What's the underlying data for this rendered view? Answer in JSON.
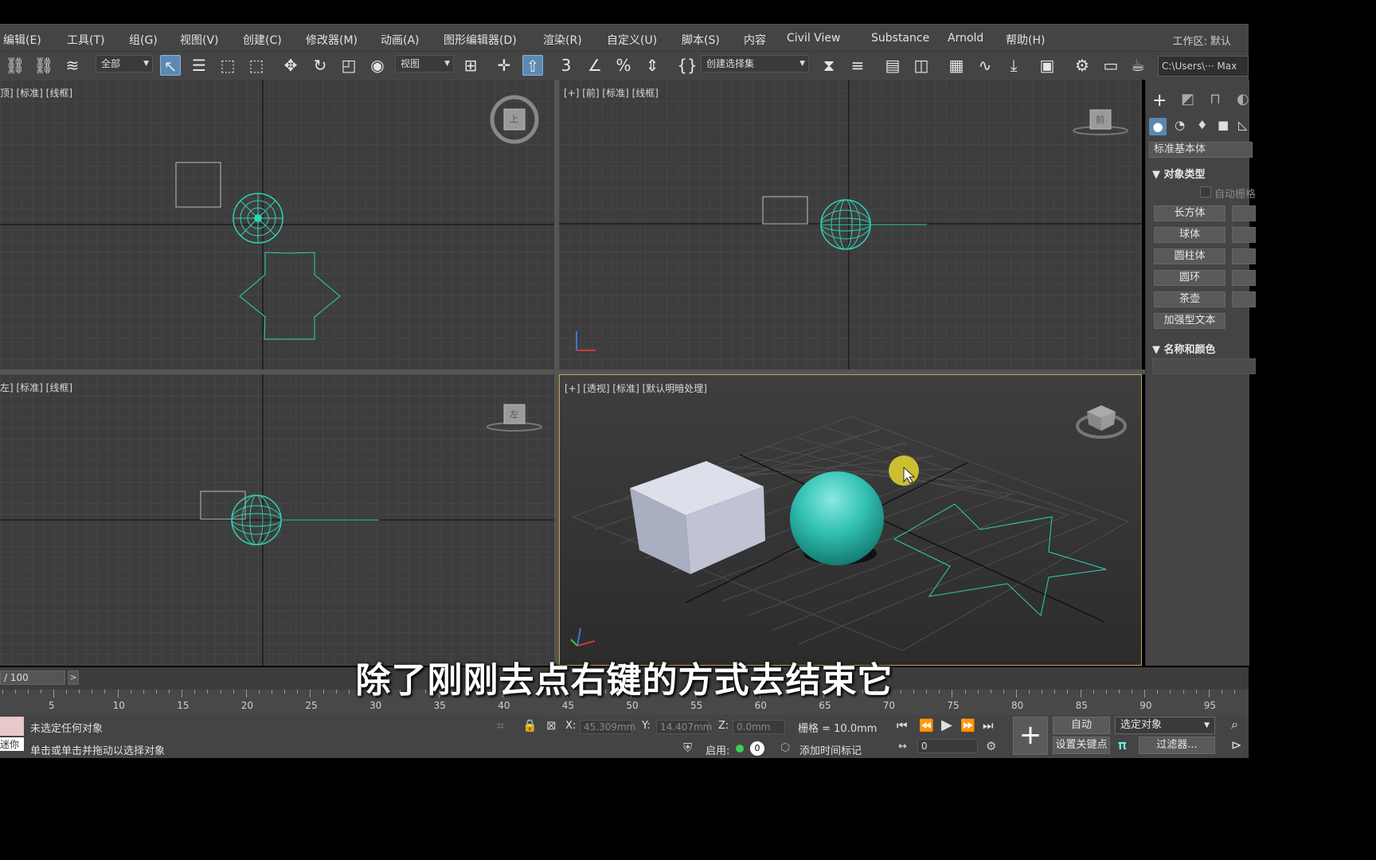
{
  "menu": [
    "编辑(E)",
    "工具(T)",
    "组(G)",
    "视图(V)",
    "创建(C)",
    "修改器(M)",
    "动画(A)",
    "图形编辑器(D)",
    "渲染(R)",
    "自定义(U)",
    "脚本(S)",
    "内容",
    "Civil View",
    "Substance",
    "Arnold",
    "帮助(H)"
  ],
  "workspace": "工作区: 默认",
  "toolbar": {
    "filter": "全部",
    "refcoord": "视图",
    "selset": "创建选择集",
    "path": "C:\\Users\\··· Max"
  },
  "viewports": {
    "top": {
      "label": "顶] [标准] [线框]"
    },
    "front": {
      "label": "[+] [前] [标准] [线框]"
    },
    "left": {
      "label": "左] [标准] [线框]"
    },
    "persp": {
      "label": "[+] [透视] [标准] [默认明暗处理]"
    }
  },
  "viewcube": {
    "top": "上",
    "front": "前",
    "left": "左"
  },
  "panel": {
    "category": "标准基本体",
    "object_type": "对象类型",
    "autogrid": "自动栅格",
    "buttons": [
      "长方体",
      "球体",
      "圆柱体",
      "圆环",
      "茶壶",
      "加强型文本"
    ],
    "name_color": "名称和颜色"
  },
  "timeline": {
    "frame": "/ 100"
  },
  "ruler": [
    "5",
    "10",
    "15",
    "20",
    "25",
    "30",
    "35",
    "40",
    "45",
    "50",
    "55",
    "60",
    "65",
    "70",
    "75",
    "80",
    "85",
    "90",
    "95"
  ],
  "status": {
    "line1": "未选定任何对象",
    "line2": "单击或单击并拖动以选择对象",
    "maxscript": "迷你",
    "x_label": "X:",
    "x": "45.309mm",
    "y_label": "Y:",
    "y": "14.407mm",
    "z_label": "Z:",
    "z": "0.0mm",
    "grid": "栅格 = 10.0mm",
    "enable": "启用:",
    "addtime": "添加时间标记",
    "auto": "自动",
    "selected": "选定对象",
    "setkey": "设置关键点",
    "filters": "过滤器...",
    "frame_field": "0",
    "key_count": "0"
  },
  "subtitle": "除了刚刚去点右键的方式去结束它",
  "colors": {
    "wire": "#2fd1b5",
    "sphere": "#32c2b4",
    "box": "#c8ccda",
    "highlight": "#c7a550",
    "cursor": "#e5d630"
  }
}
